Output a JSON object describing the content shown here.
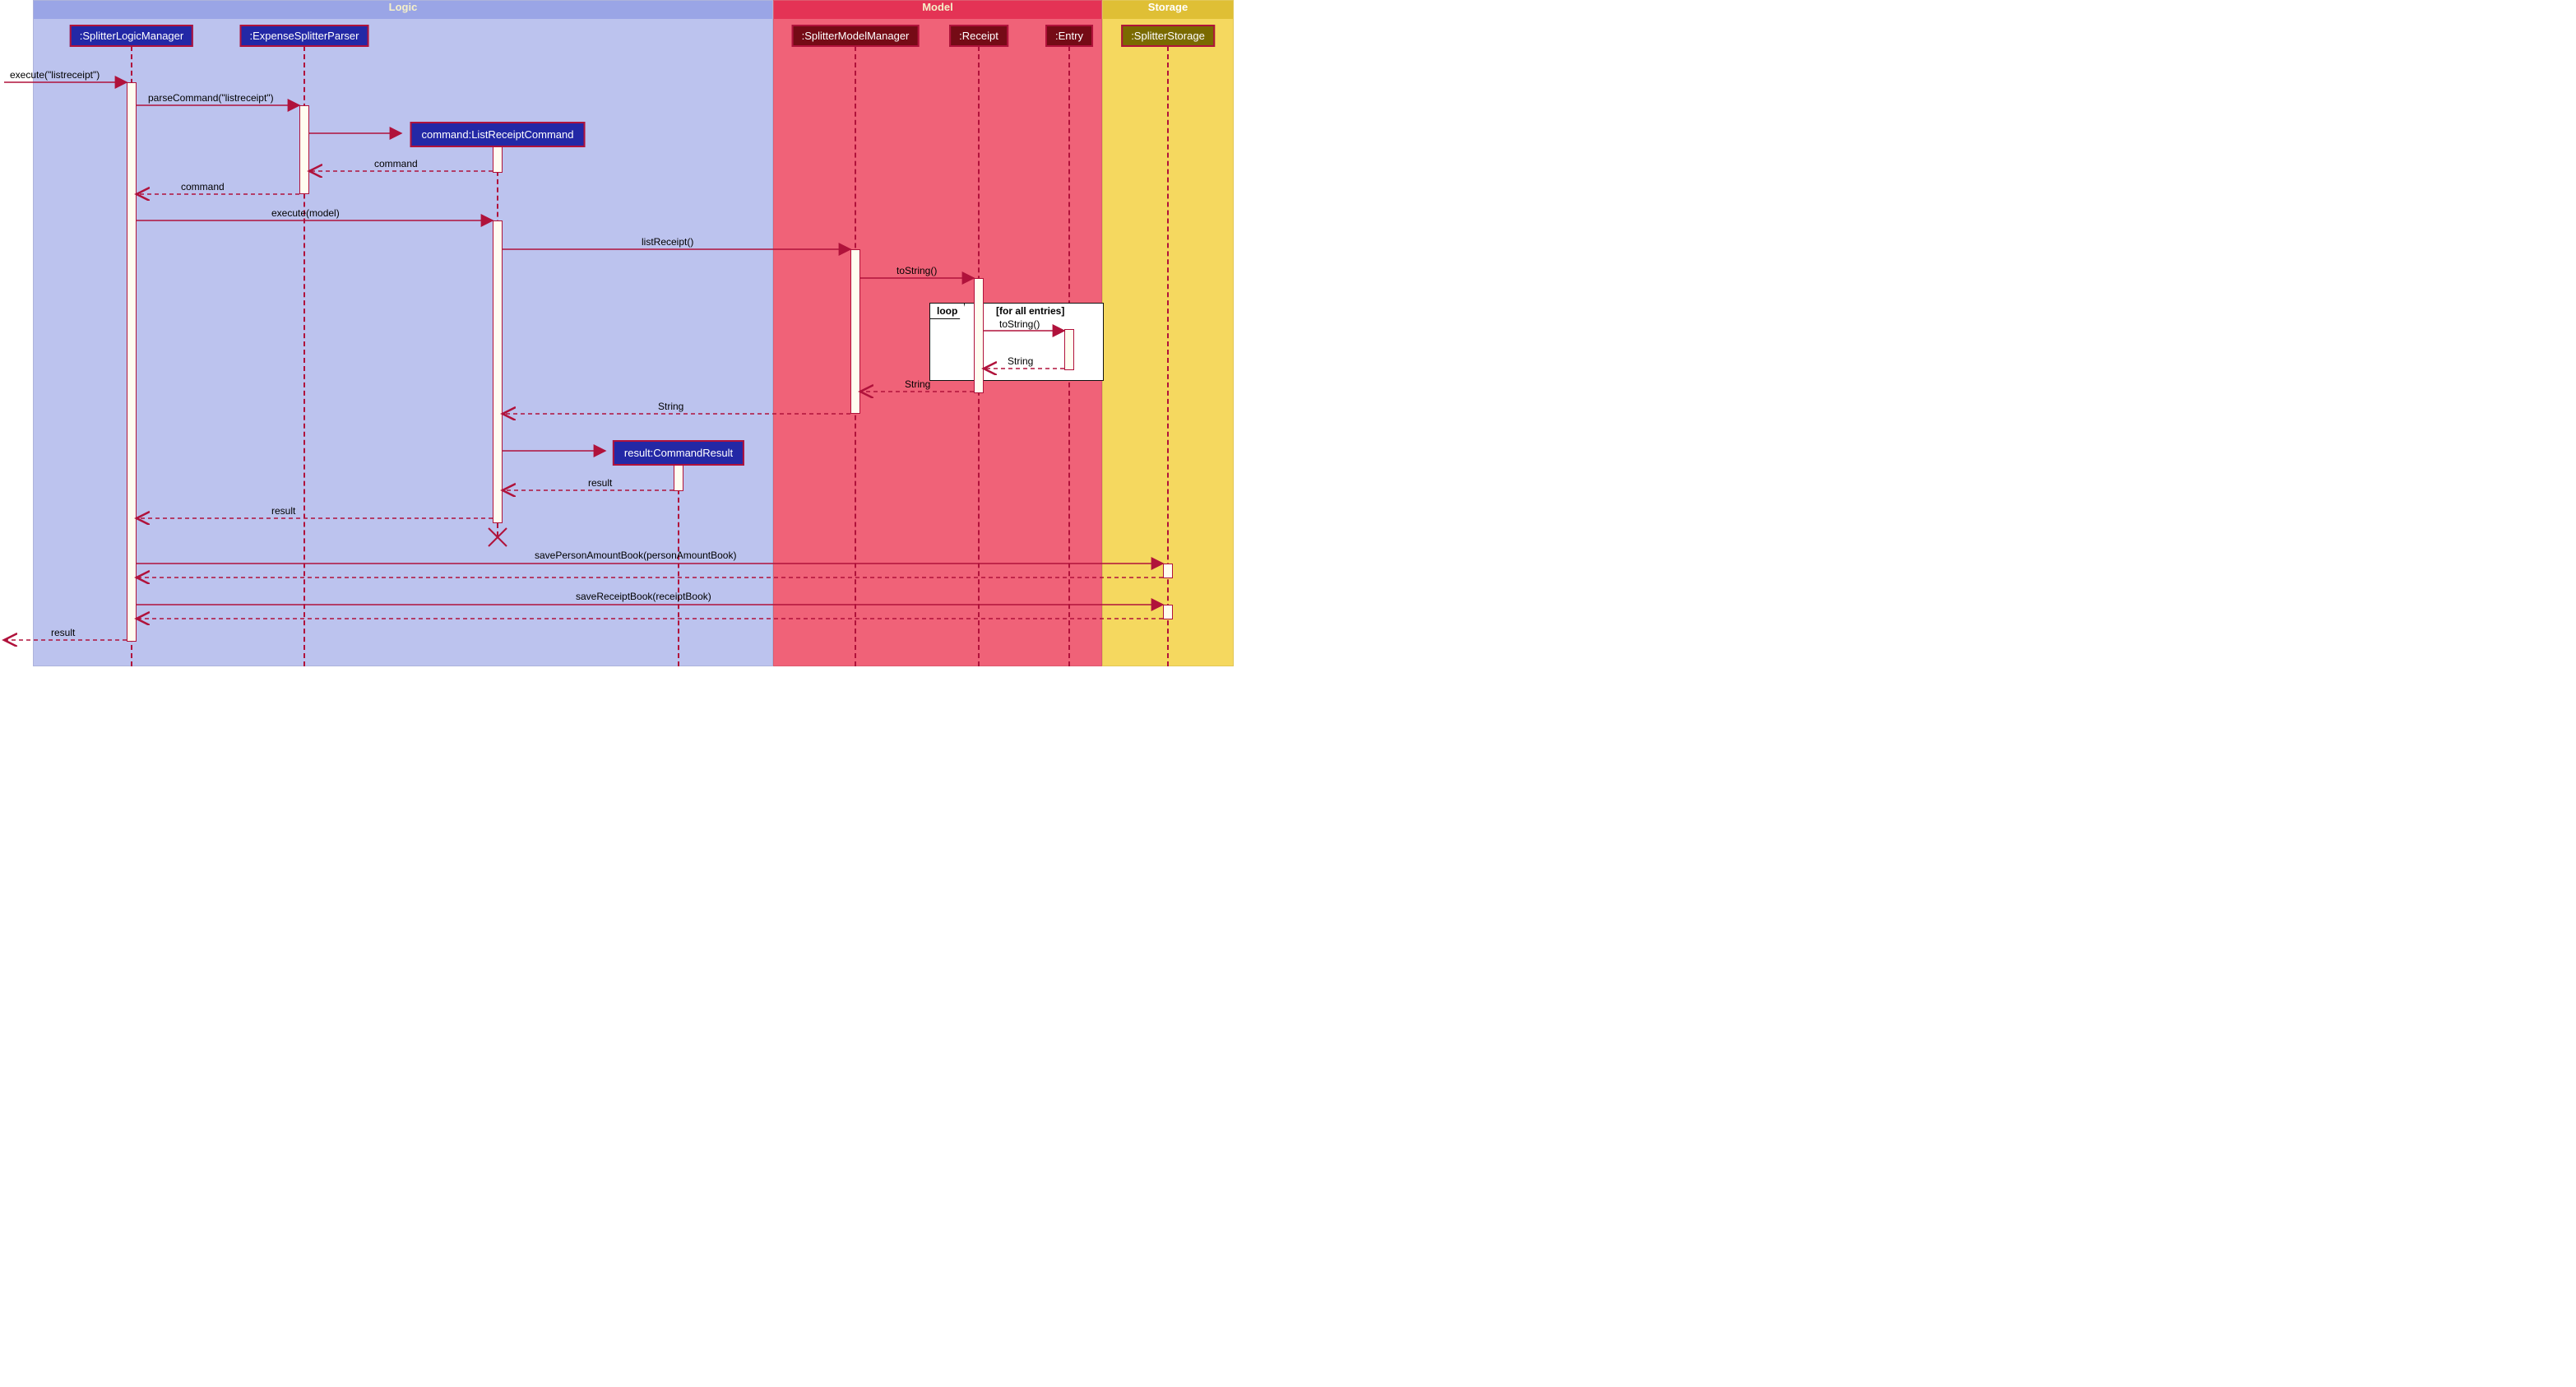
{
  "regions": {
    "logic": {
      "title": "Logic"
    },
    "model": {
      "title": "Model"
    },
    "storage": {
      "title": "Storage"
    }
  },
  "participants": {
    "logicMgr": ":SplitterLogicManager",
    "parser": ":ExpenseSplitterParser",
    "modelMgr": ":SplitterModelManager",
    "receipt": ":Receipt",
    "entry": ":Entry",
    "storage": ":SplitterStorage"
  },
  "objects": {
    "command": "command:ListReceiptCommand",
    "result": "result:CommandResult"
  },
  "loop": {
    "tag": "loop",
    "cond": "[for all entries]"
  },
  "messages": {
    "execInit": "execute(\"listreceipt\")",
    "parseCommand": "parseCommand(\"listreceipt\")",
    "retCommand1": "command",
    "retCommand2": "command",
    "execModel": "execute(model)",
    "listReceipt": "listReceipt()",
    "toString1": "toString()",
    "toString2": "toString()",
    "retString1": "String",
    "retString2": "String",
    "retString3": "String",
    "retResult": "result",
    "retResult2": "result",
    "savePerson": "savePersonAmountBook(personAmountBook)",
    "saveReceipt": "saveReceiptBook(receiptBook)",
    "finalResult": "result"
  }
}
